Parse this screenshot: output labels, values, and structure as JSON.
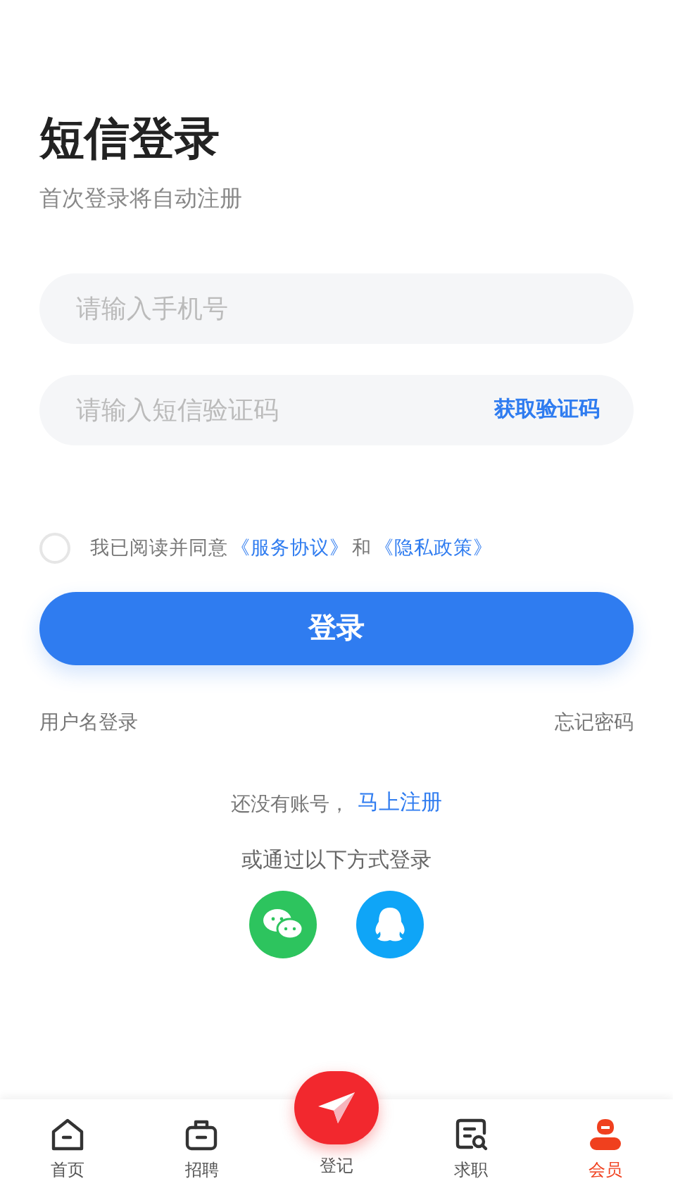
{
  "title": "短信登录",
  "subtitle": "首次登录将自动注册",
  "phone_field": {
    "placeholder": "请输入手机号"
  },
  "code_field": {
    "placeholder": "请输入短信验证码",
    "action": "获取验证码"
  },
  "agreement": {
    "checked": false,
    "parts": [
      {
        "kind": "text",
        "text": "我已阅读并同意"
      },
      {
        "kind": "link",
        "text": "《服务协议》"
      },
      {
        "kind": "text",
        "text": "和"
      },
      {
        "kind": "link",
        "text": "《隐私政策》"
      }
    ]
  },
  "login_button": "登录",
  "username_login": "用户名登录",
  "forgot_password": "忘记密码",
  "register_prompt": "还没有账号，",
  "register_link": "马上注册",
  "alt_login_label": "或通过以下方式登录",
  "alt_logins": [
    {
      "kind": "wechat"
    },
    {
      "kind": "qq"
    }
  ],
  "tabs": [
    {
      "kind": "home",
      "label": "首页",
      "selected": false
    },
    {
      "kind": "briefcase",
      "label": "招聘",
      "selected": false
    },
    {
      "kind": "post",
      "label": "登记",
      "selected": false
    },
    {
      "kind": "search-doc",
      "label": "求职",
      "selected": false
    },
    {
      "kind": "member",
      "label": "会员",
      "selected": true
    }
  ]
}
